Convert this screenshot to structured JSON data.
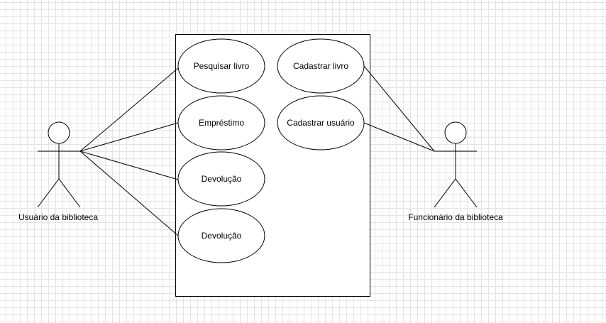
{
  "diagram": {
    "system_boundary": {
      "use_cases": [
        {
          "id": "uc1",
          "label": "Pesquisar livro"
        },
        {
          "id": "uc2",
          "label": "Empréstimo"
        },
        {
          "id": "uc3",
          "label": "Devolução"
        },
        {
          "id": "uc4",
          "label": "Devolução"
        },
        {
          "id": "uc5",
          "label": "Cadastrar livro"
        },
        {
          "id": "uc6",
          "label": "Cadastrar usuário"
        }
      ]
    },
    "actors": [
      {
        "id": "user",
        "label": "Usuário da biblioteca",
        "use_cases": [
          "uc1",
          "uc2",
          "uc3",
          "uc4"
        ]
      },
      {
        "id": "staff",
        "label": "Funcionário da biblioteca",
        "use_cases": [
          "uc5",
          "uc6"
        ]
      }
    ],
    "colors": {
      "stroke": "#000000",
      "background": "#ffffff",
      "grid": "#e4e4e4"
    }
  }
}
